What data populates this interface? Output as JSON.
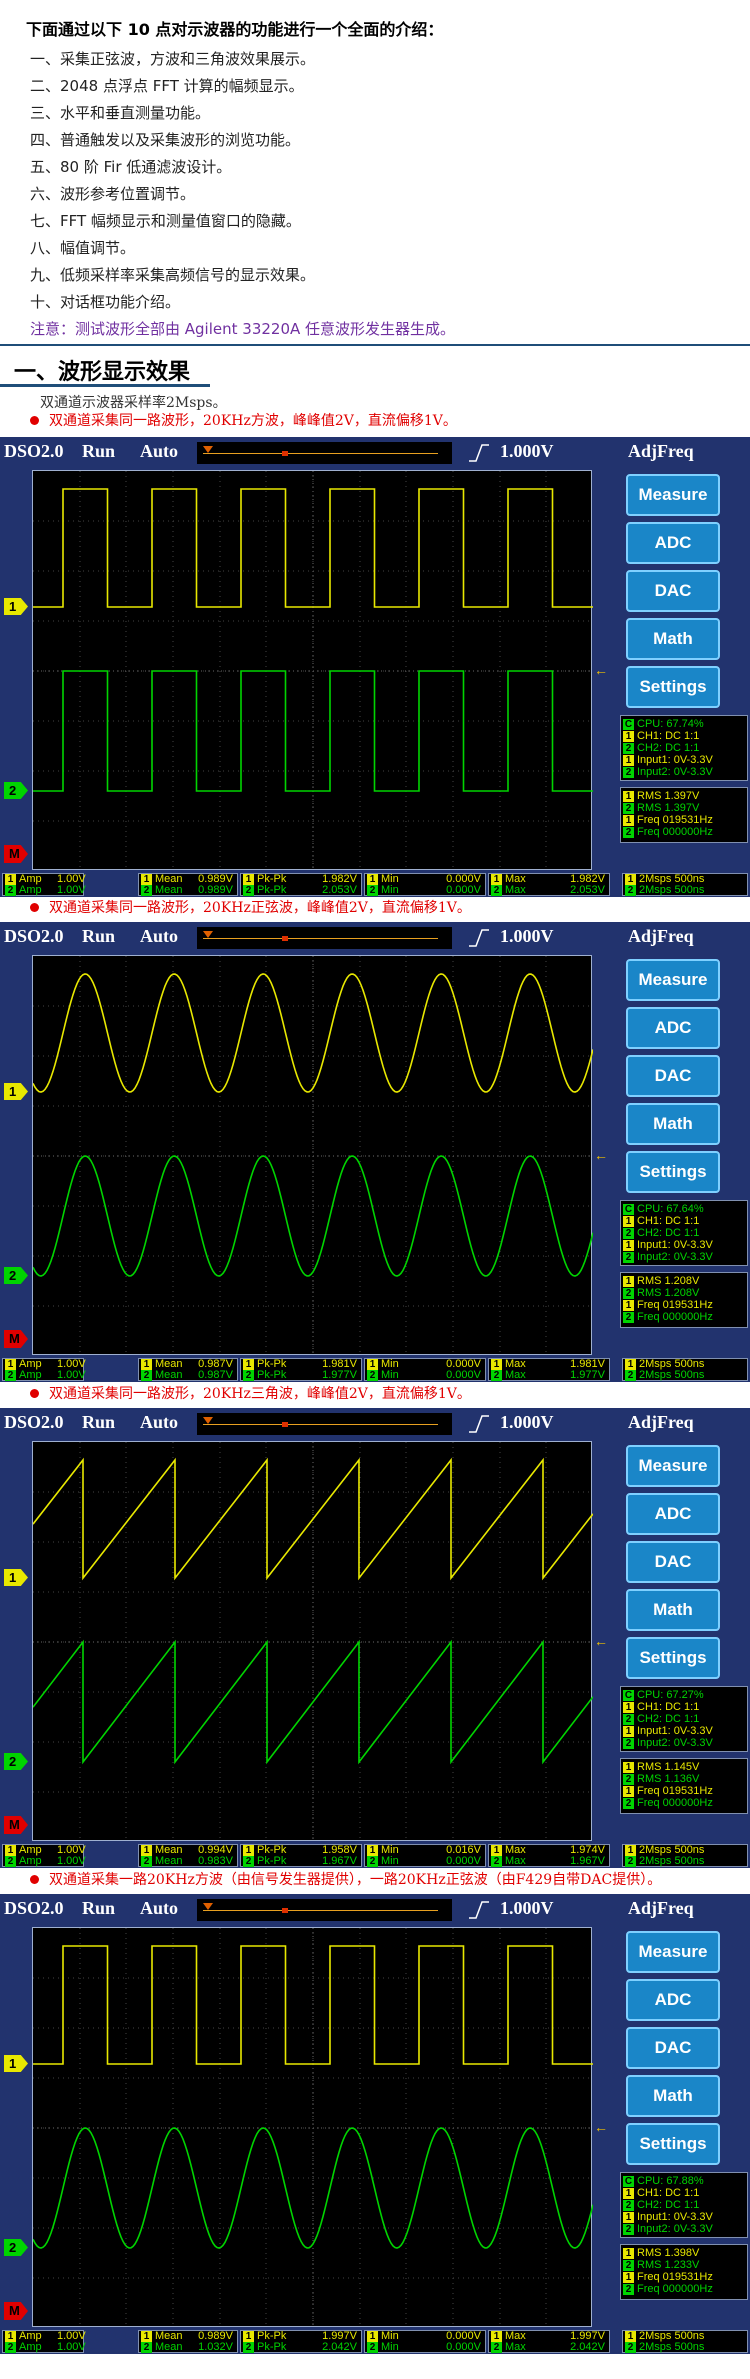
{
  "intro": {
    "heading": "下面通过以下 10 点对示波器的功能进行一个全面的介绍：",
    "items": [
      "一、采集正弦波，方波和三角波效果展示。",
      "二、2048 点浮点 FFT 计算的幅频显示。",
      "三、水平和垂直测量功能。",
      "四、普通触发以及采集波形的浏览功能。",
      "五、80 阶 Fir 低通滤波设计。",
      "六、波形参考位置调节。",
      "七、FFT 幅频显示和测量值窗口的隐藏。",
      "八、幅值调节。",
      "九、低频采样率采集高频信号的显示效果。",
      "十、对话框功能介绍。"
    ],
    "note": "注意：测试波形全部由 Agilent 33220A 任意波形发生器生成。"
  },
  "section": {
    "title": "一、波形显示效果",
    "subtitle": "双通道示波器采样率2Msps。"
  },
  "colors": {
    "ch1": "#e8e800",
    "ch2": "#00d400",
    "panel": "#22336e",
    "button": "#1a86c8"
  },
  "ui": {
    "app": "DSO2.0",
    "run": "Run",
    "auto": "Auto",
    "volt": "1.000V",
    "adj": "AdjFreq",
    "ch1_marker": "1",
    "ch2_marker": "2",
    "math_marker": "M",
    "buttons": [
      "Measure",
      "ADC",
      "DAC",
      "Math",
      "Settings"
    ]
  },
  "scopes": [
    {
      "caption": "双通道采集同一路波形，20KHz方波，峰峰值2V，直流偏移1V。",
      "wave1": "square",
      "wave2": "square",
      "cpu": "CPU: 67.74%",
      "rms1": "RMS  1.397V",
      "rms2": "RMS  1.397V",
      "freq1": "Freq  019531Hz",
      "freq2": "Freq  000000Hz",
      "amp1": "1.00V",
      "amp2": "1.00V",
      "mean1": "0.989V",
      "mean2": "0.989V",
      "pkpk1": "1.982V",
      "pkpk2": "2.053V",
      "min1": "0.000V",
      "min2": "0.000V",
      "max1": "1.982V",
      "max2": "2.053V"
    },
    {
      "caption": "双通道采集同一路波形，20KHz正弦波，峰峰值2V，直流偏移1V。",
      "wave1": "sine",
      "wave2": "sine",
      "cpu": "CPU: 67.64%",
      "rms1": "RMS  1.208V",
      "rms2": "RMS  1.208V",
      "freq1": "Freq  019531Hz",
      "freq2": "Freq  000000Hz",
      "amp1": "1.00V",
      "amp2": "1.00V",
      "mean1": "0.987V",
      "mean2": "0.987V",
      "pkpk1": "1.981V",
      "pkpk2": "1.977V",
      "min1": "0.000V",
      "min2": "0.000V",
      "max1": "1.981V",
      "max2": "1.977V"
    },
    {
      "caption": "双通道采集同一路波形，20KHz三角波，峰峰值2V，直流偏移1V。",
      "wave1": "saw",
      "wave2": "saw",
      "cpu": "CPU: 67.27%",
      "rms1": "RMS  1.145V",
      "rms2": "RMS  1.136V",
      "freq1": "Freq  019531Hz",
      "freq2": "Freq  000000Hz",
      "amp1": "1.00V",
      "amp2": "1.00V",
      "mean1": "0.994V",
      "mean2": "0.983V",
      "pkpk1": "1.958V",
      "pkpk2": "1.967V",
      "min1": "0.016V",
      "min2": "0.000V",
      "max1": "1.974V",
      "max2": "1.967V"
    },
    {
      "caption": "双通道采集一路20KHz方波（由信号发生器提供），一路20KHz正弦波（由F429自带DAC提供）。",
      "wave1": "square",
      "wave2": "sine",
      "cpu": "CPU: 67.88%",
      "rms1": "RMS  1.398V",
      "rms2": "RMS  1.233V",
      "freq1": "Freq  019531Hz",
      "freq2": "Freq  000000Hz",
      "amp1": "1.00V",
      "amp2": "1.00V",
      "mean1": "0.989V",
      "mean2": "1.032V",
      "pkpk1": "1.997V",
      "pkpk2": "2.042V",
      "min1": "0.000V",
      "min2": "0.000V",
      "max1": "1.997V",
      "max2": "2.042V"
    }
  ],
  "panel_static": {
    "ch1": "CH1: DC 1:1",
    "ch2": "CH2: DC 1:1",
    "in1": "Input1: 0V-3.3V",
    "in2": "Input2: 0V-3.3V",
    "c_tag": "C",
    "label_amp": "Amp",
    "label_mean": "Mean",
    "label_pkpk": "Pk-Pk",
    "label_min": "Min",
    "label_max": "Max",
    "rate": "2Msps 500ns"
  }
}
